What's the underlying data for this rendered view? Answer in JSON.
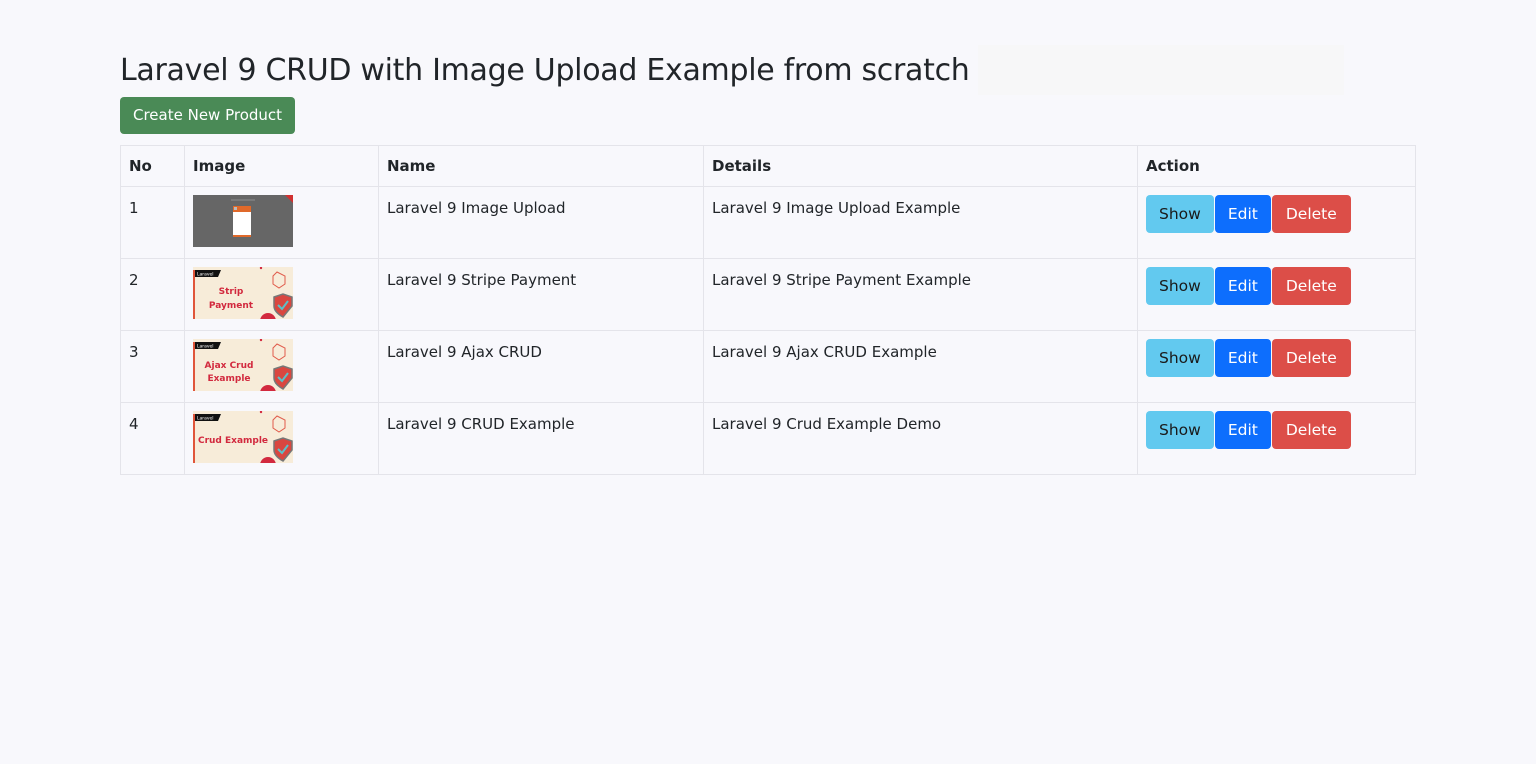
{
  "page": {
    "title": "Laravel 9 CRUD with Image Upload Example from scratch",
    "create_button": "Create New Product"
  },
  "colors": {
    "create": "#4a8a56",
    "show": "#62c9ef",
    "edit": "#0d6efd",
    "delete": "#dc4e48"
  },
  "table": {
    "headers": [
      "No",
      "Image",
      "Name",
      "Details",
      "Action"
    ],
    "rows": [
      {
        "no": "1",
        "image": "image-upload-thumbnail",
        "name": "Laravel 9 Image Upload",
        "details": "Laravel 9 Image Upload Example"
      },
      {
        "no": "2",
        "image": "stripe-payment-thumbnail",
        "image_tag": "Laravel",
        "image_text": [
          "Strip",
          "Payment"
        ],
        "name": "Laravel 9 Stripe Payment",
        "details": "Laravel 9 Stripe Payment Example"
      },
      {
        "no": "3",
        "image": "ajax-crud-thumbnail",
        "image_tag": "Laravel",
        "image_text": [
          "Ajax Crud",
          "Example"
        ],
        "name": "Laravel 9 Ajax CRUD",
        "details": "Laravel 9 Ajax CRUD Example"
      },
      {
        "no": "4",
        "image": "crud-example-thumbnail",
        "image_tag": "Laravel",
        "image_text": [
          "Crud Example"
        ],
        "name": "Laravel 9 CRUD Example",
        "details": "Laravel 9 Crud Example Demo"
      }
    ],
    "actions": {
      "show": "Show",
      "edit": "Edit",
      "delete": "Delete"
    }
  }
}
